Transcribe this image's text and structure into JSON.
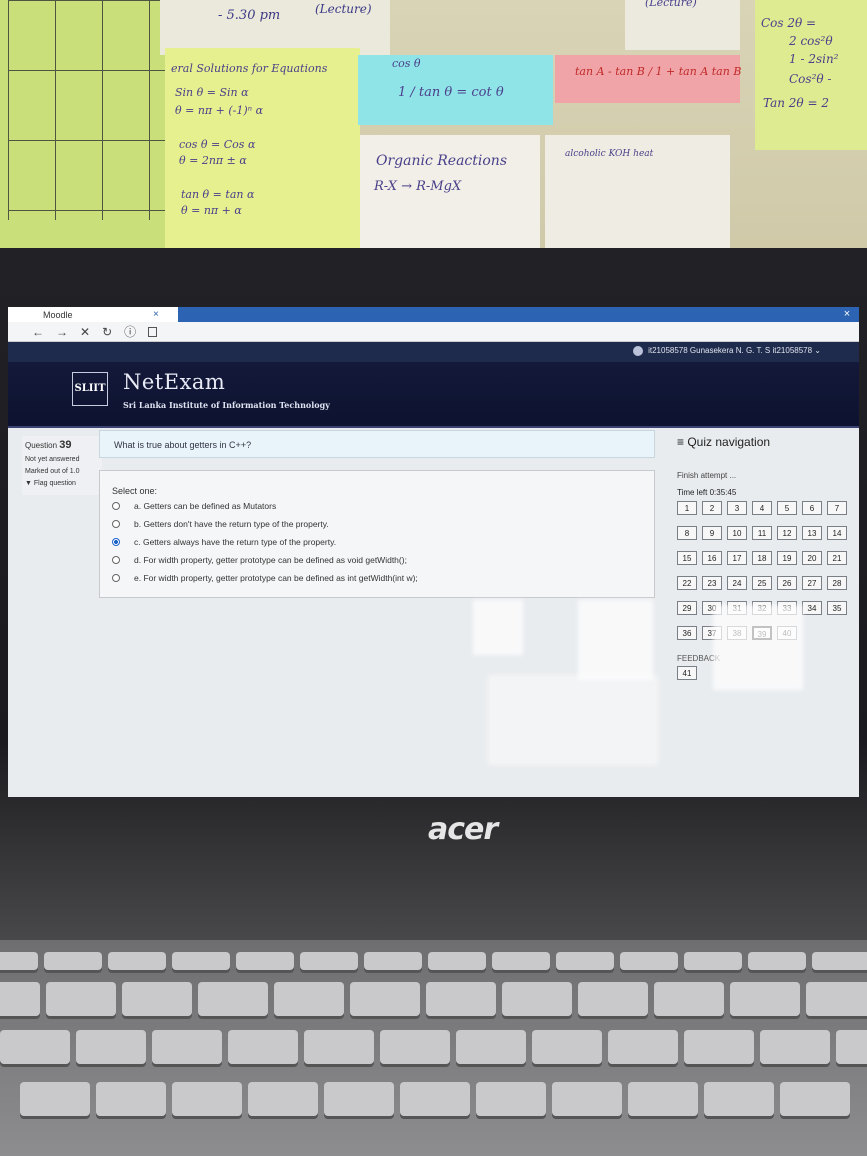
{
  "wall_notes": {
    "time": "- 5.30 pm",
    "lecture1": "(Lecture)",
    "lecture2": "(Lecture)",
    "general_title": "eral Solutions for Equations",
    "sin_line1": "Sin θ = Sin α",
    "sin_line2": "θ = nπ + (-1)ⁿ α",
    "cos_line1": "cos θ = Cos α",
    "cos_line2": "θ = 2nπ ± α",
    "tan_line1": "tan θ = tan α",
    "tan_line2": "θ = nπ + α",
    "cot_num": "cos θ",
    "cot_line": "1 / tan θ = cot θ",
    "tan_sum": "tan A - tan B / 1 + tan A tan B",
    "organic": "Organic Reactions",
    "rx": "R-X → R-MgX",
    "alcoholic": "alcoholic KOH heat",
    "right1": "Cos 2θ =",
    "right2": "2 cos²θ",
    "right3": "1 - 2sin²",
    "right4": "Cos²θ -",
    "right5": "Tan 2θ = 2"
  },
  "browser": {
    "tab_label": "Moodle",
    "tab_close": "×",
    "window_close": "×",
    "nav_back": "←",
    "nav_forward": "→",
    "nav_stop": "✕",
    "nav_reload": "↻",
    "nav_info": "ⓘ"
  },
  "header": {
    "user": "it21058578 Gunasekera N. G. T. S it21058578",
    "user_caret": "⌄",
    "brand": "NetExam",
    "brand_sub": "Sri Lanka Institute of Information Technology",
    "logo_text": "SLIIT"
  },
  "question_info": {
    "label": "Question",
    "number": "39",
    "status": "Not yet answered",
    "marks": "Marked out of 1.0",
    "flag": "Flag question"
  },
  "question": {
    "text": "What is true about getters in C++?",
    "select_label": "Select one:",
    "options": [
      {
        "label": "a. Getters can be defined as Mutators",
        "selected": false
      },
      {
        "label": "b. Getters don't have the return type of the property.",
        "selected": false
      },
      {
        "label": "c. Getters always have the return type of the property.",
        "selected": true
      },
      {
        "label": "d. For width property, getter prototype can be defined as void getWidth();",
        "selected": false
      },
      {
        "label": "e. For width property, getter prototype can be defined as int getWidth(int w);",
        "selected": false
      }
    ]
  },
  "quiz_nav": {
    "title": "≡ Quiz navigation",
    "finish": "Finish attempt ...",
    "time_left": "Time left 0:35:45",
    "questions": [
      "1",
      "2",
      "3",
      "4",
      "5",
      "6",
      "7",
      "8",
      "9",
      "10",
      "11",
      "12",
      "13",
      "14",
      "15",
      "16",
      "17",
      "18",
      "19",
      "20",
      "21",
      "22",
      "23",
      "24",
      "25",
      "26",
      "27",
      "28",
      "29",
      "30",
      "31",
      "32",
      "33",
      "34",
      "35",
      "36",
      "37",
      "38",
      "39",
      "40"
    ],
    "current": "39",
    "feedback_label": "FEEDBACK",
    "feedback_item": "41"
  },
  "laptop": {
    "brand": "acer"
  }
}
